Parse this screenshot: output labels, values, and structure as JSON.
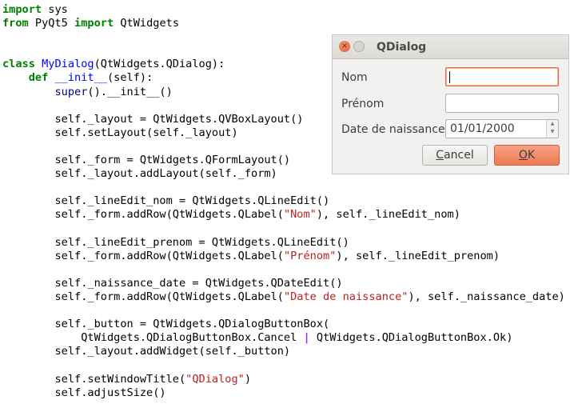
{
  "code": {
    "line_01": "import sys",
    "line_02": "from PyQt5 import QtWidgets",
    "line_03": "class MyDialog(QtWidgets.QDialog):",
    "line_04": "def __init__(self):",
    "line_05": "super().__init__()",
    "line_06": "self._layout = QtWidgets.QVBoxLayout()",
    "line_07": "self.setLayout(self._layout)",
    "line_08": "self._form = QtWidgets.QFormLayout()",
    "line_09": "self._layout.addLayout(self._form)",
    "line_10": "self._lineEdit_nom = QtWidgets.QLineEdit()",
    "line_11_pre": "self._form.addRow(QtWidgets.QLabel(",
    "line_11_str": "\"Nom\"",
    "line_11_post": "), self._lineEdit_nom)",
    "line_12": "self._lineEdit_prenom = QtWidgets.QLineEdit()",
    "line_13_pre": "self._form.addRow(QtWidgets.QLabel(",
    "line_13_str": "\"Prénom\"",
    "line_13_post": "), self._lineEdit_prenom)",
    "line_14": "self._naissance_date = QtWidgets.QDateEdit()",
    "line_15_pre": "self._form.addRow(QtWidgets.QLabel(",
    "line_15_str": "\"Date de naissance\"",
    "line_15_post": "), self._naissance_date)",
    "line_16": "self._button = QtWidgets.QDialogButtonBox(",
    "line_17_pre": "QtWidgets.QDialogButtonBox.Cancel ",
    "line_17_op": "|",
    "line_17_post": " QtWidgets.QDialogButtonBox.Ok)",
    "line_18": "self._layout.addWidget(self._button)",
    "line_19_pre": "self.setWindowTitle(",
    "line_19_str": "\"QDialog\"",
    "line_19_post": ")",
    "line_20": "self.adjustSize()"
  },
  "dialog": {
    "title": "QDialog",
    "labels": {
      "nom": "Nom",
      "prenom": "Prénom",
      "date": "Date de naissance"
    },
    "nom_value": "",
    "prenom_value": "",
    "date_value": "01/01/2000",
    "cancel_label_rest": "ancel",
    "cancel_mnemonic": "C",
    "ok_label_rest": "K",
    "ok_mnemonic": "O"
  },
  "colors": {
    "keyword": "#008000",
    "function_name": "#0000ff",
    "string": "#ba2121",
    "accent": "#ee7a52"
  },
  "icons": {
    "close": "close-icon",
    "maximize": "maximize-icon",
    "spin": "spin-arrows-icon"
  }
}
